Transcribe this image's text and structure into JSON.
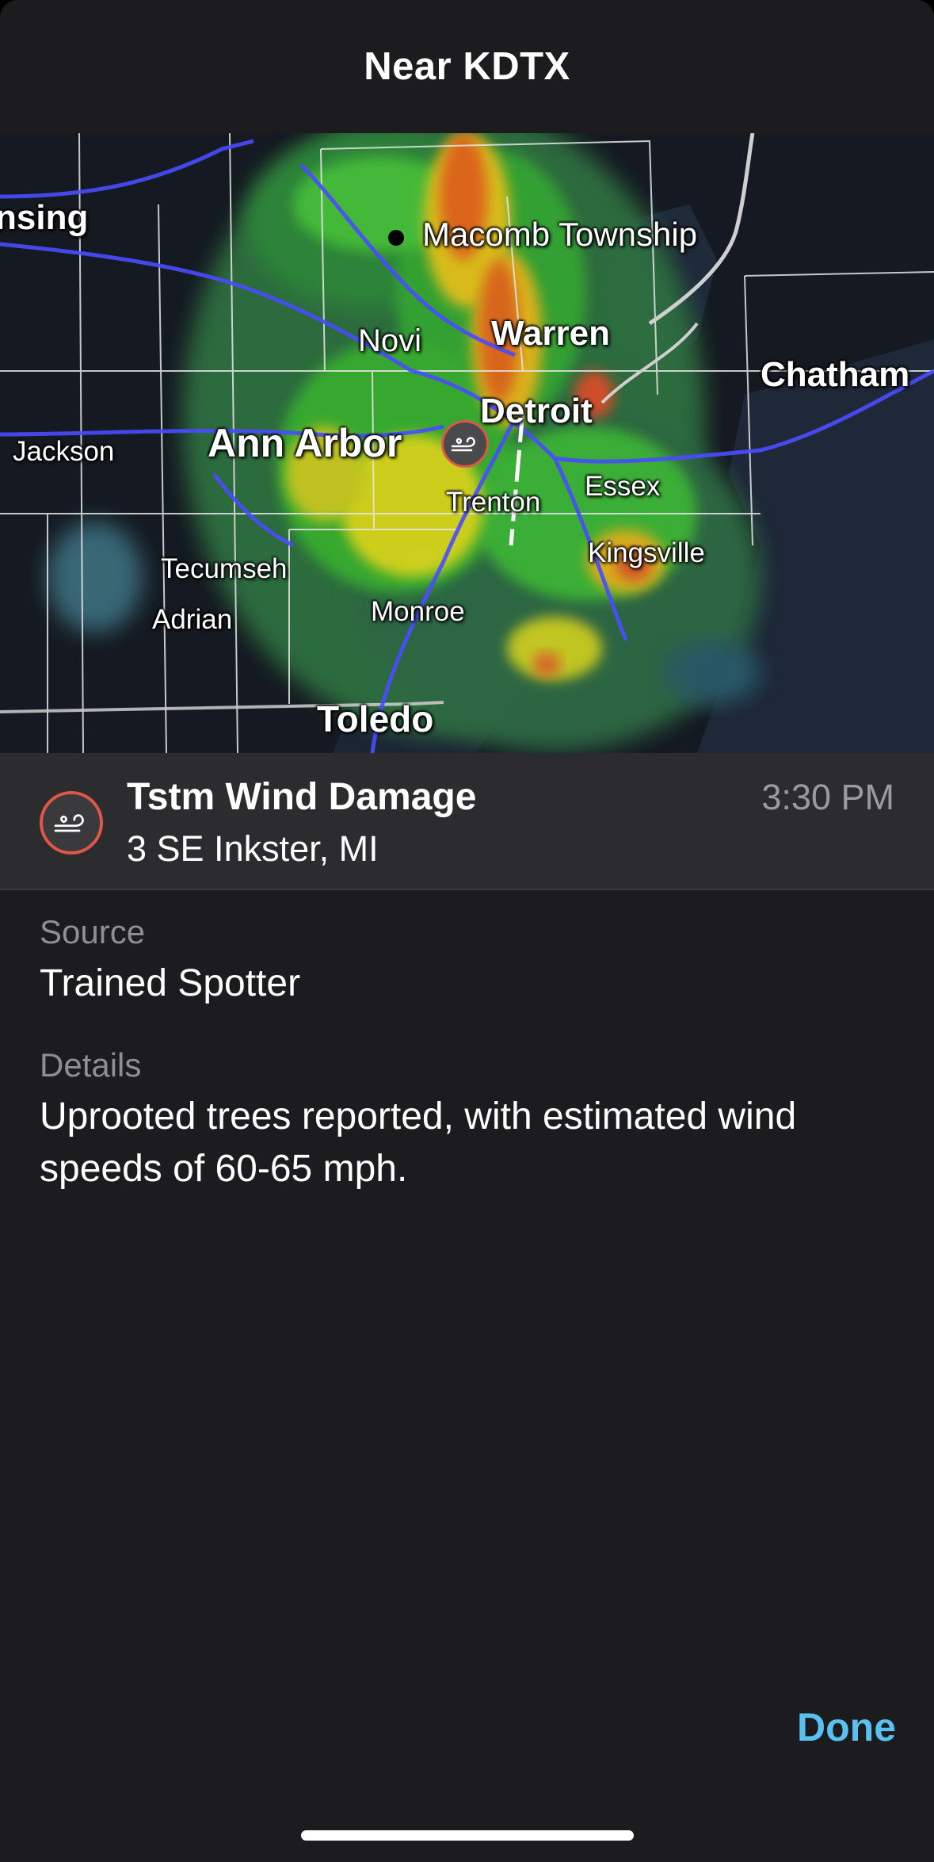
{
  "header": {
    "title": "Near KDTX"
  },
  "map": {
    "labels": {
      "lansing": "nsing",
      "macomb": "Macomb Township",
      "novi": "Novi",
      "warren": "Warren",
      "chatham": "Chatham",
      "detroit": "Detroit",
      "ann_arbor": "Ann Arbor",
      "jackson": "Jackson",
      "trenton": "Trenton",
      "essex": "Essex",
      "kingsville": "Kingsville",
      "tecumseh": "Tecumseh",
      "adrian": "Adrian",
      "monroe": "Monroe",
      "toledo": "Toledo"
    },
    "marker_icon": "wind-icon"
  },
  "report": {
    "title": "Tstm Wind Damage",
    "location": "3 SE Inkster, MI",
    "time": "3:30 PM",
    "icon": "wind-icon",
    "accent_color": "#e0574a"
  },
  "source": {
    "label": "Source",
    "value": "Trained Spotter"
  },
  "details": {
    "label": "Details",
    "value": "Uprooted trees reported, with estimated wind speeds of 60-65 mph."
  },
  "footer": {
    "done_label": "Done",
    "done_color": "#5ac0f0"
  }
}
